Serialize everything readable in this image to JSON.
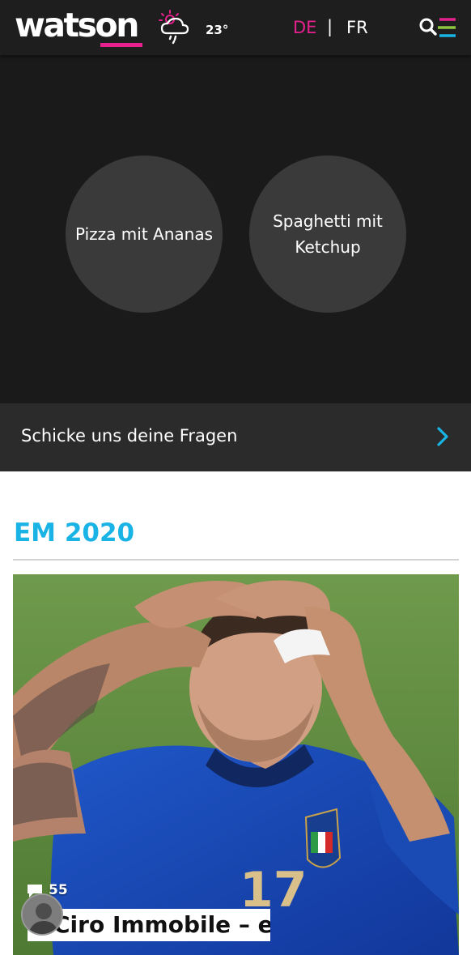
{
  "header": {
    "logo_text": "watson",
    "weather": {
      "icon": "sun-cloud-rain-icon",
      "temperature": "23°"
    },
    "languages": {
      "active": "DE",
      "separator": "|",
      "other": "FR"
    },
    "menu_icon": "search-menu-icon",
    "colors": {
      "brand_pink": "#e6208c",
      "accent_blue": "#1ab3e6",
      "accent_green": "#8dc63f"
    }
  },
  "quiz": {
    "choices": [
      {
        "label": "Pizza mit Ananas"
      },
      {
        "label": "Spaghetti mit Ketchup"
      }
    ]
  },
  "ask_bar": {
    "label": "Schicke uns deine Fragen",
    "icon": "chevron-right-icon"
  },
  "section": {
    "title": "EM 2020"
  },
  "article": {
    "comment_count": "55",
    "headline": "Ciro Immobile – ein"
  }
}
